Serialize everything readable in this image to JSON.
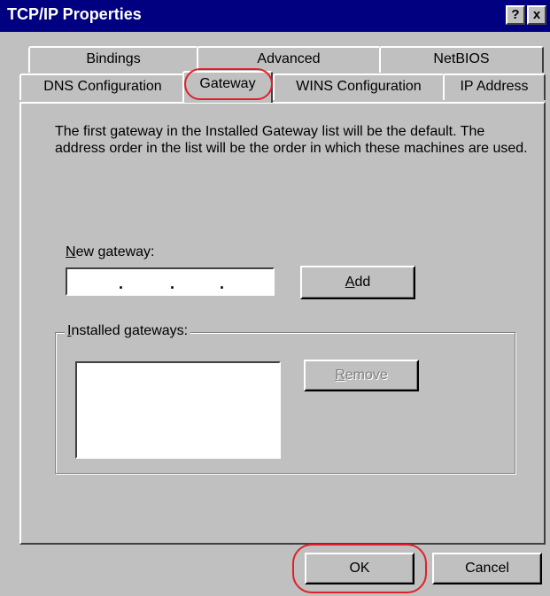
{
  "window": {
    "title": "TCP/IP Properties",
    "help_label": "?",
    "close_label": "x"
  },
  "tabs": {
    "row1": [
      "Bindings",
      "Advanced",
      "NetBIOS"
    ],
    "row2": [
      "DNS Configuration",
      "Gateway",
      "WINS Configuration",
      "IP Address"
    ],
    "active": "Gateway"
  },
  "gateway": {
    "description": "The first gateway in the Installed Gateway list will be the default. The address order in the list will be the order in which these machines are used.",
    "new_gateway_label_first": "N",
    "new_gateway_label_rest": "ew gateway:",
    "ip_value": "",
    "add_label_first": "A",
    "add_label_rest": "dd",
    "installed_label_first": "I",
    "installed_label_rest": "nstalled gateways:",
    "installed_items": [],
    "remove_label_first": "R",
    "remove_label_rest": "emove"
  },
  "footer": {
    "ok_label": "OK",
    "cancel_label": "Cancel"
  },
  "colors": {
    "title_bar": "#000080",
    "dialog_face": "#c0c0c0",
    "highlight_circle": "#e0202a"
  }
}
